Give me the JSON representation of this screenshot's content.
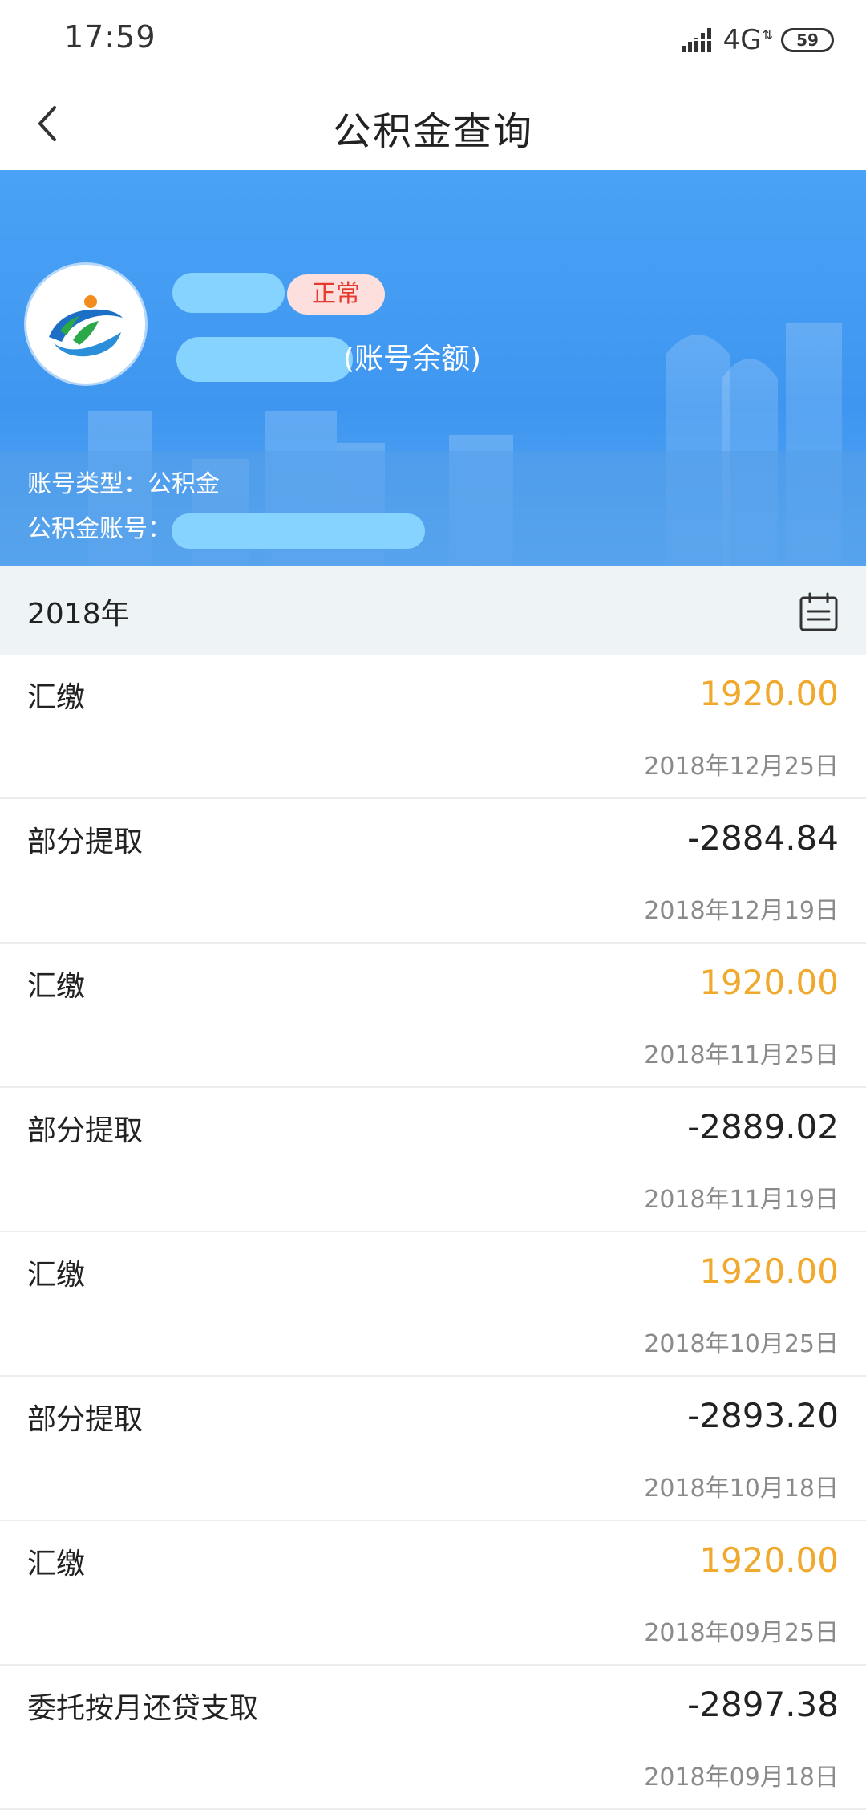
{
  "status_bar": {
    "time": "17:59",
    "network": "4G",
    "battery": "59"
  },
  "nav": {
    "title": "公积金查询"
  },
  "account": {
    "status": "正常",
    "balance_label": "(账号余额)",
    "type_line": "账号类型：公积金",
    "account_number_label": "公积金账号："
  },
  "year_header": {
    "year": "2018年"
  },
  "transactions": [
    {
      "type": "汇缴",
      "amount": "1920.00",
      "date": "2018年12月25日"
    },
    {
      "type": "部分提取",
      "amount": "-2884.84",
      "date": "2018年12月19日"
    },
    {
      "type": "汇缴",
      "amount": "1920.00",
      "date": "2018年11月25日"
    },
    {
      "type": "部分提取",
      "amount": "-2889.02",
      "date": "2018年11月19日"
    },
    {
      "type": "汇缴",
      "amount": "1920.00",
      "date": "2018年10月25日"
    },
    {
      "type": "部分提取",
      "amount": "-2893.20",
      "date": "2018年10月18日"
    },
    {
      "type": "汇缴",
      "amount": "1920.00",
      "date": "2018年09月25日"
    },
    {
      "type": "委托按月还贷支取",
      "amount": "-2897.38",
      "date": "2018年09月18日"
    }
  ],
  "colors": {
    "header_blue": "#3e96f0",
    "positive_amount": "#f0a92d",
    "status_badge_text": "#e53b2f",
    "status_badge_bg": "#fde0dd",
    "mask": "#86d3ff"
  }
}
